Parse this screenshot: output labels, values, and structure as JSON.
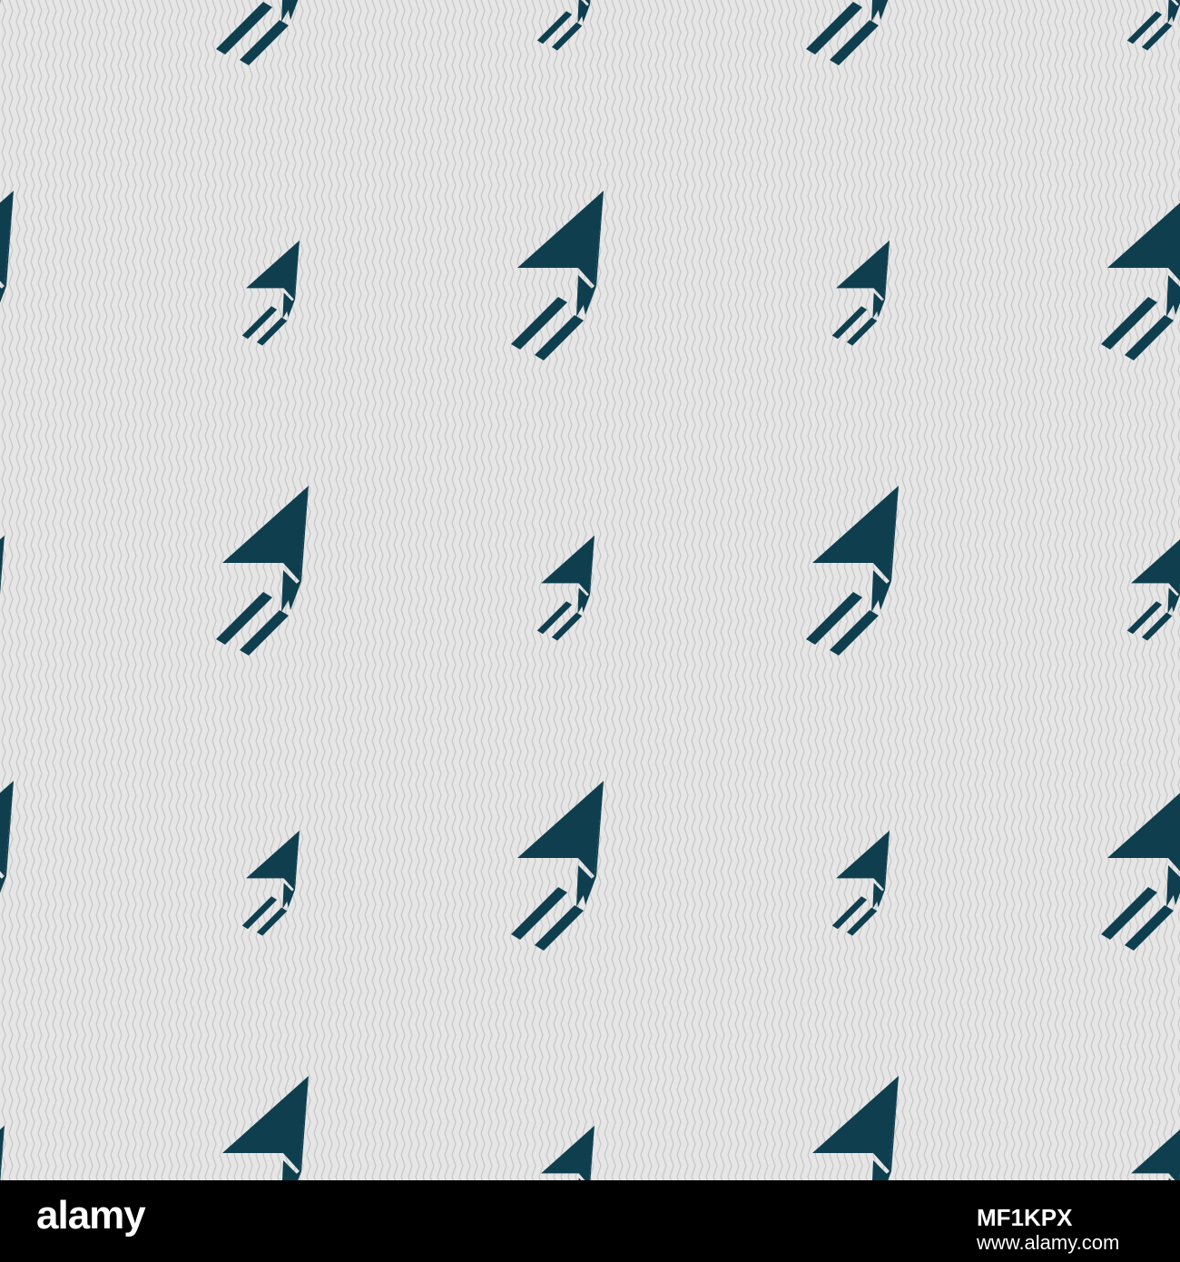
{
  "pattern": {
    "icon": "paper-plane-icon",
    "icon_color": "#0f3f4f",
    "background_color": "#e6e6e6",
    "zigzag_color": "#c8c8c8"
  },
  "footer": {
    "logo": "alamy",
    "image_id": "MF1KPX",
    "url": "www.alamy.com",
    "background_color": "#000000",
    "text_color": "#ffffff"
  }
}
